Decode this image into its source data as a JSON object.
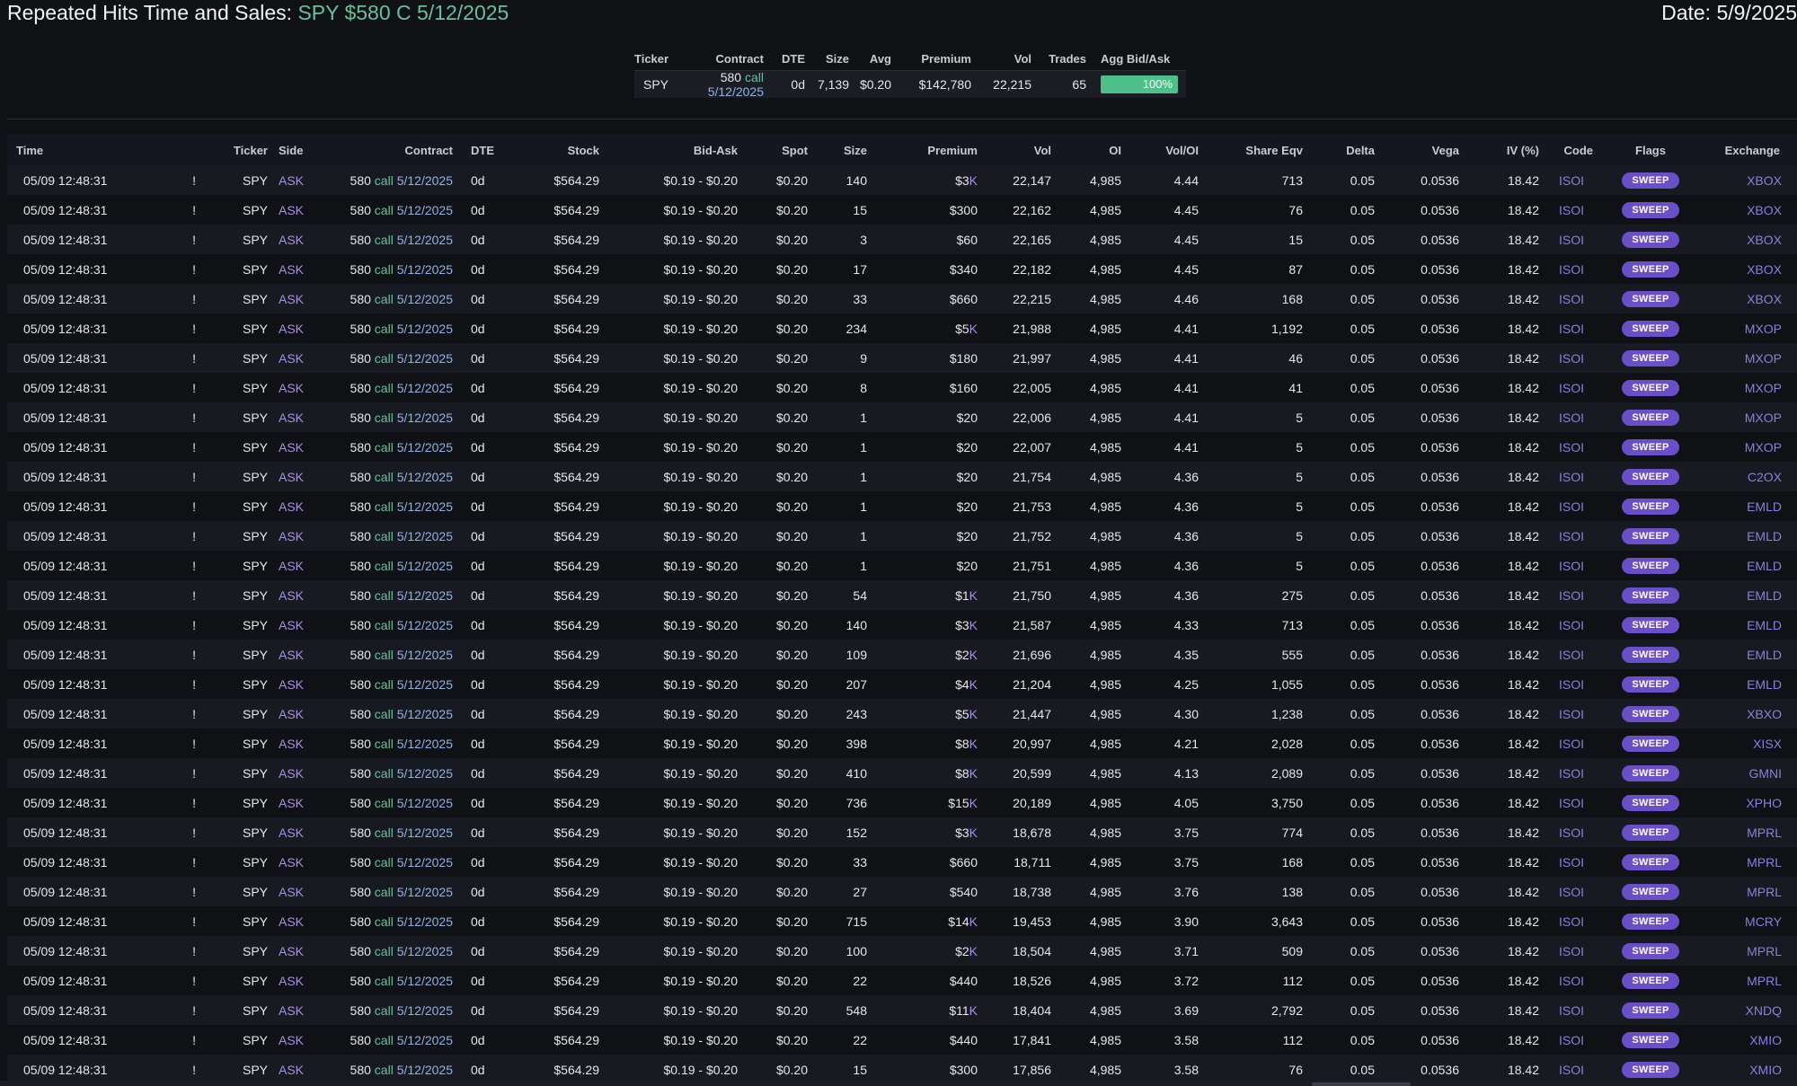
{
  "header": {
    "title_prefix": "Repeated Hits Time and Sales:",
    "title_contract": "SPY $580 C 5/12/2025",
    "date": "Date: 5/9/2025"
  },
  "summary": {
    "headers": [
      "Ticker",
      "Contract",
      "DTE",
      "Size",
      "Avg",
      "Premium",
      "Vol",
      "Trades",
      "Agg Bid/Ask"
    ],
    "ticker": "SPY",
    "strike": "580",
    "type": "call",
    "expiry": "5/12/2025",
    "dte": "0d",
    "size": "7,139",
    "avg": "$0.20",
    "premium": "$142,780",
    "vol": "22,215",
    "trades": "65",
    "agg": "100%",
    "agg_fraction": 1.0
  },
  "table": {
    "headers": [
      "Time",
      "",
      "Ticker",
      "Side",
      "Contract",
      "DTE",
      "Stock",
      "Bid-Ask",
      "Spot",
      "Size",
      "Premium",
      "Vol",
      "OI",
      "Vol/OI",
      "Share Eqv",
      "Delta",
      "Vega",
      "IV (%)",
      "Code",
      "Flags",
      "Exchange"
    ],
    "rows": [
      [
        "05/09 12:48:31",
        "!",
        "SPY",
        "ASK",
        "580",
        "call",
        "5/12/2025",
        "0d",
        "$564.29",
        "$0.19 - $0.20",
        "$0.20",
        "140",
        "$3K",
        "22,147",
        "4,985",
        "4.44",
        "713",
        "0.05",
        "0.0536",
        "18.42",
        "ISOI",
        "SWEEP",
        "XBOX"
      ],
      [
        "05/09 12:48:31",
        "!",
        "SPY",
        "ASK",
        "580",
        "call",
        "5/12/2025",
        "0d",
        "$564.29",
        "$0.19 - $0.20",
        "$0.20",
        "15",
        "$300",
        "22,162",
        "4,985",
        "4.45",
        "76",
        "0.05",
        "0.0536",
        "18.42",
        "ISOI",
        "SWEEP",
        "XBOX"
      ],
      [
        "05/09 12:48:31",
        "!",
        "SPY",
        "ASK",
        "580",
        "call",
        "5/12/2025",
        "0d",
        "$564.29",
        "$0.19 - $0.20",
        "$0.20",
        "3",
        "$60",
        "22,165",
        "4,985",
        "4.45",
        "15",
        "0.05",
        "0.0536",
        "18.42",
        "ISOI",
        "SWEEP",
        "XBOX"
      ],
      [
        "05/09 12:48:31",
        "!",
        "SPY",
        "ASK",
        "580",
        "call",
        "5/12/2025",
        "0d",
        "$564.29",
        "$0.19 - $0.20",
        "$0.20",
        "17",
        "$340",
        "22,182",
        "4,985",
        "4.45",
        "87",
        "0.05",
        "0.0536",
        "18.42",
        "ISOI",
        "SWEEP",
        "XBOX"
      ],
      [
        "05/09 12:48:31",
        "!",
        "SPY",
        "ASK",
        "580",
        "call",
        "5/12/2025",
        "0d",
        "$564.29",
        "$0.19 - $0.20",
        "$0.20",
        "33",
        "$660",
        "22,215",
        "4,985",
        "4.46",
        "168",
        "0.05",
        "0.0536",
        "18.42",
        "ISOI",
        "SWEEP",
        "XBOX"
      ],
      [
        "05/09 12:48:31",
        "!",
        "SPY",
        "ASK",
        "580",
        "call",
        "5/12/2025",
        "0d",
        "$564.29",
        "$0.19 - $0.20",
        "$0.20",
        "234",
        "$5K",
        "21,988",
        "4,985",
        "4.41",
        "1,192",
        "0.05",
        "0.0536",
        "18.42",
        "ISOI",
        "SWEEP",
        "MXOP"
      ],
      [
        "05/09 12:48:31",
        "!",
        "SPY",
        "ASK",
        "580",
        "call",
        "5/12/2025",
        "0d",
        "$564.29",
        "$0.19 - $0.20",
        "$0.20",
        "9",
        "$180",
        "21,997",
        "4,985",
        "4.41",
        "46",
        "0.05",
        "0.0536",
        "18.42",
        "ISOI",
        "SWEEP",
        "MXOP"
      ],
      [
        "05/09 12:48:31",
        "!",
        "SPY",
        "ASK",
        "580",
        "call",
        "5/12/2025",
        "0d",
        "$564.29",
        "$0.19 - $0.20",
        "$0.20",
        "8",
        "$160",
        "22,005",
        "4,985",
        "4.41",
        "41",
        "0.05",
        "0.0536",
        "18.42",
        "ISOI",
        "SWEEP",
        "MXOP"
      ],
      [
        "05/09 12:48:31",
        "!",
        "SPY",
        "ASK",
        "580",
        "call",
        "5/12/2025",
        "0d",
        "$564.29",
        "$0.19 - $0.20",
        "$0.20",
        "1",
        "$20",
        "22,006",
        "4,985",
        "4.41",
        "5",
        "0.05",
        "0.0536",
        "18.42",
        "ISOI",
        "SWEEP",
        "MXOP"
      ],
      [
        "05/09 12:48:31",
        "!",
        "SPY",
        "ASK",
        "580",
        "call",
        "5/12/2025",
        "0d",
        "$564.29",
        "$0.19 - $0.20",
        "$0.20",
        "1",
        "$20",
        "22,007",
        "4,985",
        "4.41",
        "5",
        "0.05",
        "0.0536",
        "18.42",
        "ISOI",
        "SWEEP",
        "MXOP"
      ],
      [
        "05/09 12:48:31",
        "!",
        "SPY",
        "ASK",
        "580",
        "call",
        "5/12/2025",
        "0d",
        "$564.29",
        "$0.19 - $0.20",
        "$0.20",
        "1",
        "$20",
        "21,754",
        "4,985",
        "4.36",
        "5",
        "0.05",
        "0.0536",
        "18.42",
        "ISOI",
        "SWEEP",
        "C2OX"
      ],
      [
        "05/09 12:48:31",
        "!",
        "SPY",
        "ASK",
        "580",
        "call",
        "5/12/2025",
        "0d",
        "$564.29",
        "$0.19 - $0.20",
        "$0.20",
        "1",
        "$20",
        "21,753",
        "4,985",
        "4.36",
        "5",
        "0.05",
        "0.0536",
        "18.42",
        "ISOI",
        "SWEEP",
        "EMLD"
      ],
      [
        "05/09 12:48:31",
        "!",
        "SPY",
        "ASK",
        "580",
        "call",
        "5/12/2025",
        "0d",
        "$564.29",
        "$0.19 - $0.20",
        "$0.20",
        "1",
        "$20",
        "21,752",
        "4,985",
        "4.36",
        "5",
        "0.05",
        "0.0536",
        "18.42",
        "ISOI",
        "SWEEP",
        "EMLD"
      ],
      [
        "05/09 12:48:31",
        "!",
        "SPY",
        "ASK",
        "580",
        "call",
        "5/12/2025",
        "0d",
        "$564.29",
        "$0.19 - $0.20",
        "$0.20",
        "1",
        "$20",
        "21,751",
        "4,985",
        "4.36",
        "5",
        "0.05",
        "0.0536",
        "18.42",
        "ISOI",
        "SWEEP",
        "EMLD"
      ],
      [
        "05/09 12:48:31",
        "!",
        "SPY",
        "ASK",
        "580",
        "call",
        "5/12/2025",
        "0d",
        "$564.29",
        "$0.19 - $0.20",
        "$0.20",
        "54",
        "$1K",
        "21,750",
        "4,985",
        "4.36",
        "275",
        "0.05",
        "0.0536",
        "18.42",
        "ISOI",
        "SWEEP",
        "EMLD"
      ],
      [
        "05/09 12:48:31",
        "!",
        "SPY",
        "ASK",
        "580",
        "call",
        "5/12/2025",
        "0d",
        "$564.29",
        "$0.19 - $0.20",
        "$0.20",
        "140",
        "$3K",
        "21,587",
        "4,985",
        "4.33",
        "713",
        "0.05",
        "0.0536",
        "18.42",
        "ISOI",
        "SWEEP",
        "EMLD"
      ],
      [
        "05/09 12:48:31",
        "!",
        "SPY",
        "ASK",
        "580",
        "call",
        "5/12/2025",
        "0d",
        "$564.29",
        "$0.19 - $0.20",
        "$0.20",
        "109",
        "$2K",
        "21,696",
        "4,985",
        "4.35",
        "555",
        "0.05",
        "0.0536",
        "18.42",
        "ISOI",
        "SWEEP",
        "EMLD"
      ],
      [
        "05/09 12:48:31",
        "!",
        "SPY",
        "ASK",
        "580",
        "call",
        "5/12/2025",
        "0d",
        "$564.29",
        "$0.19 - $0.20",
        "$0.20",
        "207",
        "$4K",
        "21,204",
        "4,985",
        "4.25",
        "1,055",
        "0.05",
        "0.0536",
        "18.42",
        "ISOI",
        "SWEEP",
        "EMLD"
      ],
      [
        "05/09 12:48:31",
        "!",
        "SPY",
        "ASK",
        "580",
        "call",
        "5/12/2025",
        "0d",
        "$564.29",
        "$0.19 - $0.20",
        "$0.20",
        "243",
        "$5K",
        "21,447",
        "4,985",
        "4.30",
        "1,238",
        "0.05",
        "0.0536",
        "18.42",
        "ISOI",
        "SWEEP",
        "XBXO"
      ],
      [
        "05/09 12:48:31",
        "!",
        "SPY",
        "ASK",
        "580",
        "call",
        "5/12/2025",
        "0d",
        "$564.29",
        "$0.19 - $0.20",
        "$0.20",
        "398",
        "$8K",
        "20,997",
        "4,985",
        "4.21",
        "2,028",
        "0.05",
        "0.0536",
        "18.42",
        "ISOI",
        "SWEEP",
        "XISX"
      ],
      [
        "05/09 12:48:31",
        "!",
        "SPY",
        "ASK",
        "580",
        "call",
        "5/12/2025",
        "0d",
        "$564.29",
        "$0.19 - $0.20",
        "$0.20",
        "410",
        "$8K",
        "20,599",
        "4,985",
        "4.13",
        "2,089",
        "0.05",
        "0.0536",
        "18.42",
        "ISOI",
        "SWEEP",
        "GMNI"
      ],
      [
        "05/09 12:48:31",
        "!",
        "SPY",
        "ASK",
        "580",
        "call",
        "5/12/2025",
        "0d",
        "$564.29",
        "$0.19 - $0.20",
        "$0.20",
        "736",
        "$15K",
        "20,189",
        "4,985",
        "4.05",
        "3,750",
        "0.05",
        "0.0536",
        "18.42",
        "ISOI",
        "SWEEP",
        "XPHO"
      ],
      [
        "05/09 12:48:31",
        "!",
        "SPY",
        "ASK",
        "580",
        "call",
        "5/12/2025",
        "0d",
        "$564.29",
        "$0.19 - $0.20",
        "$0.20",
        "152",
        "$3K",
        "18,678",
        "4,985",
        "3.75",
        "774",
        "0.05",
        "0.0536",
        "18.42",
        "ISOI",
        "SWEEP",
        "MPRL"
      ],
      [
        "05/09 12:48:31",
        "!",
        "SPY",
        "ASK",
        "580",
        "call",
        "5/12/2025",
        "0d",
        "$564.29",
        "$0.19 - $0.20",
        "$0.20",
        "33",
        "$660",
        "18,711",
        "4,985",
        "3.75",
        "168",
        "0.05",
        "0.0536",
        "18.42",
        "ISOI",
        "SWEEP",
        "MPRL"
      ],
      [
        "05/09 12:48:31",
        "!",
        "SPY",
        "ASK",
        "580",
        "call",
        "5/12/2025",
        "0d",
        "$564.29",
        "$0.19 - $0.20",
        "$0.20",
        "27",
        "$540",
        "18,738",
        "4,985",
        "3.76",
        "138",
        "0.05",
        "0.0536",
        "18.42",
        "ISOI",
        "SWEEP",
        "MPRL"
      ],
      [
        "05/09 12:48:31",
        "!",
        "SPY",
        "ASK",
        "580",
        "call",
        "5/12/2025",
        "0d",
        "$564.29",
        "$0.19 - $0.20",
        "$0.20",
        "715",
        "$14K",
        "19,453",
        "4,985",
        "3.90",
        "3,643",
        "0.05",
        "0.0536",
        "18.42",
        "ISOI",
        "SWEEP",
        "MCRY"
      ],
      [
        "05/09 12:48:31",
        "!",
        "SPY",
        "ASK",
        "580",
        "call",
        "5/12/2025",
        "0d",
        "$564.29",
        "$0.19 - $0.20",
        "$0.20",
        "100",
        "$2K",
        "18,504",
        "4,985",
        "3.71",
        "509",
        "0.05",
        "0.0536",
        "18.42",
        "ISOI",
        "SWEEP",
        "MPRL"
      ],
      [
        "05/09 12:48:31",
        "!",
        "SPY",
        "ASK",
        "580",
        "call",
        "5/12/2025",
        "0d",
        "$564.29",
        "$0.19 - $0.20",
        "$0.20",
        "22",
        "$440",
        "18,526",
        "4,985",
        "3.72",
        "112",
        "0.05",
        "0.0536",
        "18.42",
        "ISOI",
        "SWEEP",
        "MPRL"
      ],
      [
        "05/09 12:48:31",
        "!",
        "SPY",
        "ASK",
        "580",
        "call",
        "5/12/2025",
        "0d",
        "$564.29",
        "$0.19 - $0.20",
        "$0.20",
        "548",
        "$11K",
        "18,404",
        "4,985",
        "3.69",
        "2,792",
        "0.05",
        "0.0536",
        "18.42",
        "ISOI",
        "SWEEP",
        "XNDQ"
      ],
      [
        "05/09 12:48:31",
        "!",
        "SPY",
        "ASK",
        "580",
        "call",
        "5/12/2025",
        "0d",
        "$564.29",
        "$0.19 - $0.20",
        "$0.20",
        "22",
        "$440",
        "17,841",
        "4,985",
        "3.58",
        "112",
        "0.05",
        "0.0536",
        "18.42",
        "ISOI",
        "SWEEP",
        "XMIO"
      ],
      [
        "05/09 12:48:31",
        "!",
        "SPY",
        "ASK",
        "580",
        "call",
        "5/12/2025",
        "0d",
        "$564.29",
        "$0.19 - $0.20",
        "$0.20",
        "15",
        "$300",
        "17,856",
        "4,985",
        "3.58",
        "76",
        "0.05",
        "0.0536",
        "18.42",
        "ISOI",
        "SWEEP",
        "XMIO"
      ]
    ]
  },
  "colors": {
    "background": "#0f1115",
    "accent_green": "#66c29a",
    "ask_purple": "#a98ee8",
    "sweep_badge": "#6a4fc9",
    "agg_bar": "#4fbf8a"
  }
}
